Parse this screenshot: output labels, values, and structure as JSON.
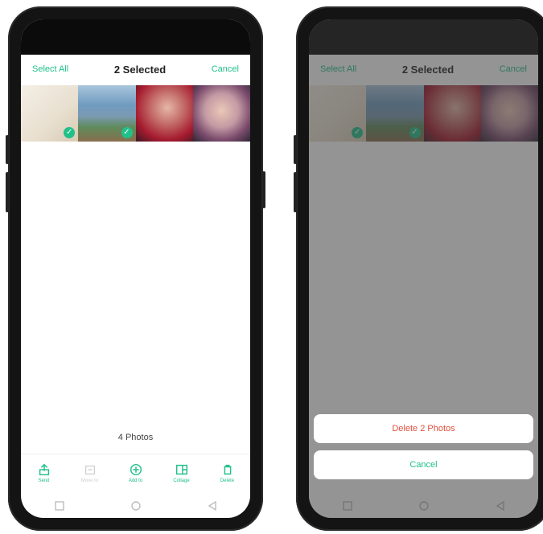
{
  "header": {
    "select_all": "Select All",
    "title": "2 Selected",
    "cancel": "Cancel"
  },
  "grid": {
    "photos": [
      {
        "selected": true
      },
      {
        "selected": true
      },
      {
        "selected": false
      },
      {
        "selected": false
      }
    ],
    "count_label": "4 Photos"
  },
  "toolbar": {
    "send": "Send",
    "move_to": "Move to",
    "add_to": "Add to",
    "collage": "Collage",
    "delete": "Delete"
  },
  "dialog": {
    "delete_label": "Delete 2 Photos",
    "cancel_label": "Cancel"
  },
  "colors": {
    "accent": "#21c089",
    "danger": "#e0503f"
  }
}
